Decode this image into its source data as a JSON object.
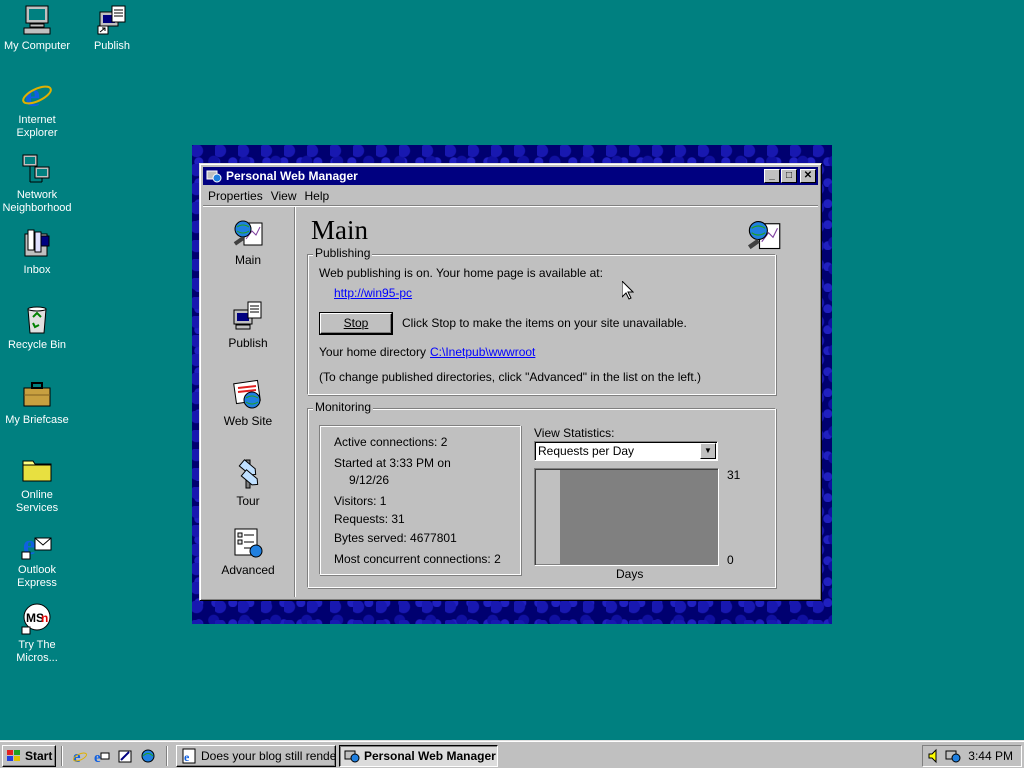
{
  "desktop": {
    "icons": [
      {
        "label": "My Computer",
        "icon": "my-computer-icon"
      },
      {
        "label": "Publish",
        "icon": "publish-icon"
      },
      {
        "label": "Internet\nExplorer",
        "icon": "internet-explorer-icon"
      },
      {
        "label": "Network\nNeighborhood",
        "icon": "network-neighborhood-icon"
      },
      {
        "label": "Inbox",
        "icon": "inbox-icon"
      },
      {
        "label": "Recycle Bin",
        "icon": "recycle-bin-icon"
      },
      {
        "label": "My Briefcase",
        "icon": "briefcase-icon"
      },
      {
        "label": "Online\nServices",
        "icon": "folder-icon"
      },
      {
        "label": "Outlook\nExpress",
        "icon": "outlook-express-icon"
      },
      {
        "label": "Try The\nMicros...",
        "icon": "msn-icon"
      }
    ]
  },
  "window": {
    "title": "Personal Web Manager",
    "menu": [
      "Properties",
      "View",
      "Help"
    ],
    "nav": [
      {
        "label": "Main",
        "icon": "main-icon"
      },
      {
        "label": "Publish",
        "icon": "publish-icon"
      },
      {
        "label": "Web Site",
        "icon": "web-site-icon"
      },
      {
        "label": "Tour",
        "icon": "tour-icon"
      },
      {
        "label": "Advanced",
        "icon": "advanced-icon"
      }
    ],
    "main": {
      "heading": "Main",
      "publishing": {
        "legend": "Publishing",
        "status": "Web publishing is on. Your home page is available at:",
        "url": "http://win95-pc",
        "stop_label": "Stop",
        "stop_hint": "Click Stop to make the items on your site unavailable.",
        "home_dir_label": "Your home directory",
        "home_dir": "C:\\Inetpub\\wwwroot",
        "note": "(To change published directories, click \"Advanced\" in the list on the left.)"
      },
      "monitoring": {
        "legend": "Monitoring",
        "active_connections": "Active connections:  2",
        "started_line1": "Started at 3:33 PM on",
        "started_line2": "9/12/26",
        "visitors": "Visitors:  1",
        "requests": "Requests:  31",
        "bytes_served": "Bytes served:  4677801",
        "concurrent": "Most concurrent connections:  2",
        "view_stats_label": "View Statistics:",
        "view_stats_selected": "Requests per Day",
        "graph_max": "31",
        "graph_min": "0",
        "graph_xlabel": "Days"
      }
    }
  },
  "chart_data": {
    "type": "bar",
    "title": "",
    "xlabel": "Days",
    "ylabel": "",
    "ylim": [
      0,
      31
    ],
    "categories": [
      ""
    ],
    "values": [
      31
    ]
  },
  "taskbar": {
    "start_label": "Start",
    "tasks": [
      {
        "label": "Does your blog still render i...",
        "active": false
      },
      {
        "label": "Personal Web Manager",
        "active": true
      }
    ],
    "clock": "3:44 PM"
  },
  "colors": {
    "desktop": "#008080",
    "title_bar": "#000080",
    "face": "#c0c0c0",
    "link": "#0000ff"
  }
}
